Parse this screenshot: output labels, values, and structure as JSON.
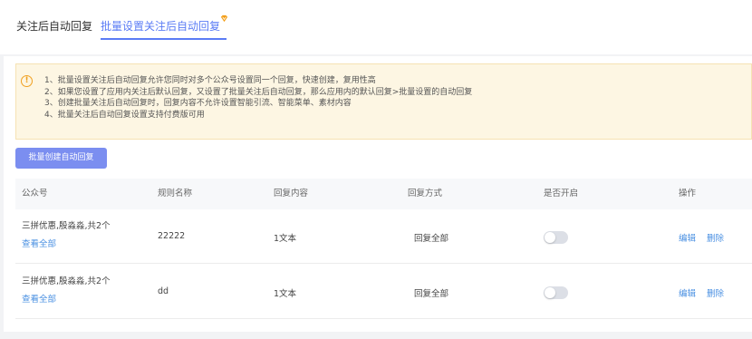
{
  "tabs": [
    {
      "label": "关注后自动回复"
    },
    {
      "label": "批量设置关注后自动回复"
    }
  ],
  "notice": {
    "icon": "info-icon",
    "lines": [
      "1、批量设置关注后自动回复允许您同时对多个公众号设置同一个回复，快速创建，复用性高",
      "2、如果您设置了应用内关注后默认回复，又设置了批量关注后自动回复，那么应用内的默认回复>批量设置的自动回复",
      "3、创建批量关注后自动回复时，回复内容不允许设置智能引流、智能菜单、素材内容",
      "4、批量关注后自动回复设置支持付费版可用"
    ]
  },
  "create_button": "批量创建自动回复",
  "table": {
    "headers": [
      "公众号",
      "规则名称",
      "回复内容",
      "回复方式",
      "是否开启",
      "操作"
    ],
    "rows": [
      {
        "account": "三拼优惠,殷淼淼,共2个",
        "view_all": "查看全部",
        "rule": "22222",
        "content": "1文本",
        "mode": "回复全部",
        "enabled": false,
        "edit": "编辑",
        "delete": "删除"
      },
      {
        "account": "三拼优惠,殷淼淼,共2个",
        "view_all": "查看全部",
        "rule": "dd",
        "content": "1文本",
        "mode": "回复全部",
        "enabled": false,
        "edit": "编辑",
        "delete": "删除"
      }
    ]
  },
  "colors": {
    "accent": "#5b7cf5",
    "button": "#7b8ef0",
    "link": "#4a90e2",
    "notice_bg": "#fdf6e3",
    "vip_badge": "#f39c12"
  }
}
